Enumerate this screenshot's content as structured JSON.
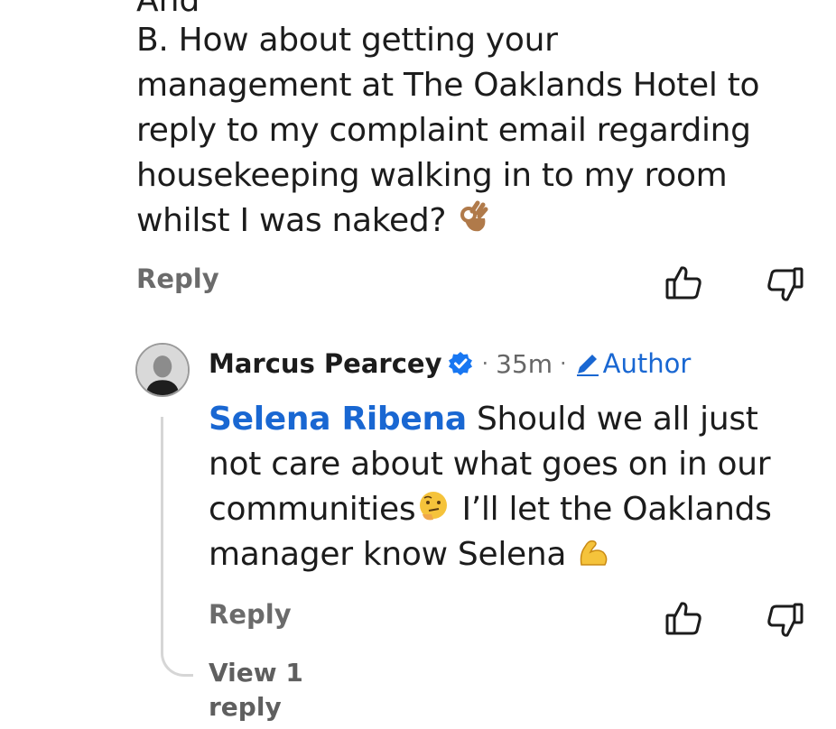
{
  "comment": {
    "truncated_top_text": "And",
    "lines": [
      "B. How about getting your",
      "management at The Oaklands Hotel to",
      "reply to my complaint email regarding",
      "housekeeping walking in to my room",
      "whilst I was naked?"
    ],
    "emoji": "ok-hand-emoji",
    "reply_label": "Reply"
  },
  "reply": {
    "author_name": "Marcus Pearcey",
    "separator": "·",
    "time_ago": "35m",
    "author_tag": "Author",
    "mention": "Selena Ribena",
    "lines": [
      " Should we all just",
      "not care about what goes on in our",
      "communities",
      " I’ll let the Oaklands",
      "manager know Selena"
    ],
    "emojis": [
      "thinking-face-emoji",
      "flexed-biceps-emoji"
    ],
    "reply_label": "Reply",
    "view_replies_line1": "View 1",
    "view_replies_line2": "reply"
  },
  "colors": {
    "link_blue": "#1967d2",
    "muted_gray": "#6b6b6b",
    "verified_blue": "#1877f2"
  }
}
